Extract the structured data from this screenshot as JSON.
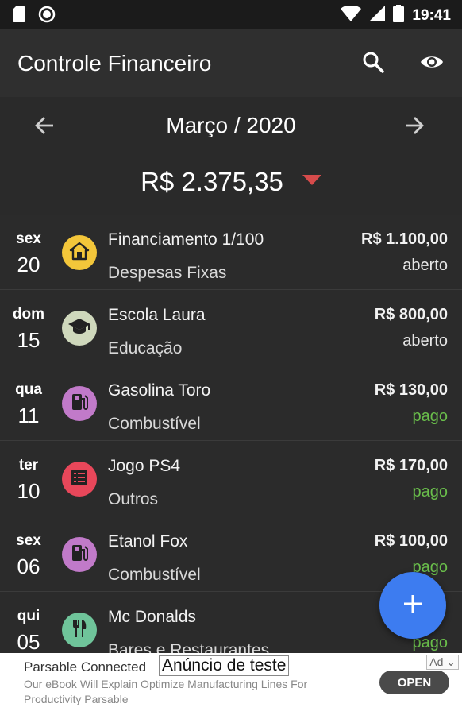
{
  "status_bar": {
    "time": "19:41",
    "icons": [
      "sd-card-icon",
      "record-icon",
      "wifi-icon",
      "signal-icon",
      "battery-icon"
    ]
  },
  "app_bar": {
    "title": "Controle Financeiro",
    "actions": [
      "search-icon",
      "eye-icon"
    ]
  },
  "month_header": {
    "month": "Março / 2020",
    "balance": "R$ 2.375,35",
    "balance_indicator_color": "#d64b4b"
  },
  "transactions": [
    {
      "weekday": "sex",
      "day": "20",
      "name": "Financiamento 1/100",
      "category": "Despesas Fixas",
      "amount": "R$ 1.100,00",
      "status": "aberto",
      "icon": "home-icon",
      "icon_bg": "#f3c63a"
    },
    {
      "weekday": "dom",
      "day": "15",
      "name": "Escola Laura",
      "category": "Educação",
      "amount": "R$ 800,00",
      "status": "aberto",
      "icon": "graduation-cap-icon",
      "icon_bg": "#cfd8bc"
    },
    {
      "weekday": "qua",
      "day": "11",
      "name": "Gasolina Toro",
      "category": "Combustível",
      "amount": "R$ 130,00",
      "status": "pago",
      "icon": "fuel-pump-icon",
      "icon_bg": "#c17ac9"
    },
    {
      "weekday": "ter",
      "day": "10",
      "name": "Jogo PS4",
      "category": "Outros",
      "amount": "R$ 170,00",
      "status": "pago",
      "icon": "list-icon",
      "icon_bg": "#e8475a"
    },
    {
      "weekday": "sex",
      "day": "06",
      "name": "Etanol Fox",
      "category": "Combustível",
      "amount": "R$ 100,00",
      "status": "pago",
      "icon": "fuel-pump-icon",
      "icon_bg": "#c17ac9"
    },
    {
      "weekday": "qui",
      "day": "05",
      "name": "Mc Donalds",
      "category": "Bares e Restaurantes",
      "amount": "",
      "status": "pago",
      "icon": "fork-knife-icon",
      "icon_bg": "#6fc49a"
    }
  ],
  "colors": {
    "open_status": "#e6e6e6",
    "paid_status": "#6abf4b",
    "fab": "#3d7cf0"
  },
  "fab": {
    "icon": "plus-icon"
  },
  "ad": {
    "title": "Parsable Connected",
    "test_label": "Anúncio de teste",
    "description": "Our eBook Will Explain Optimize Manufacturing Lines For Productivity Parsable",
    "cta": "OPEN",
    "tag": "Ad"
  }
}
